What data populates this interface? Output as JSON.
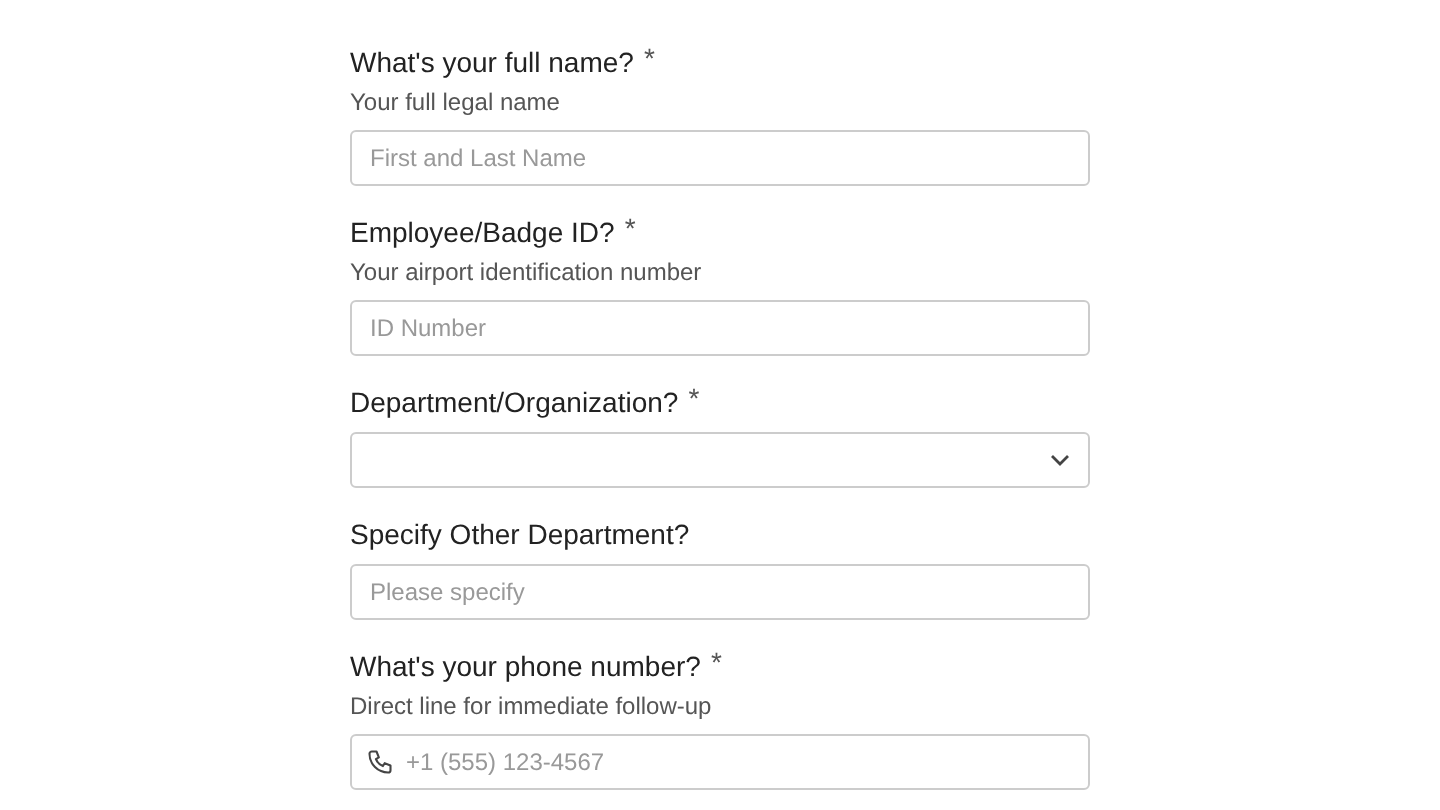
{
  "fields": [
    {
      "kind": "text",
      "label": "What's your full name?",
      "required_mark": "*",
      "hint": "Your full legal name",
      "placeholder": "First and Last Name"
    },
    {
      "kind": "text",
      "label": "Employee/Badge ID?",
      "required_mark": "*",
      "hint": "Your airport identification number",
      "placeholder": "ID Number"
    },
    {
      "kind": "select",
      "label": "Department/Organization?",
      "required_mark": "*"
    },
    {
      "kind": "text",
      "label": "Specify Other Department?",
      "placeholder": "Please specify"
    },
    {
      "kind": "phone",
      "label": "What's your phone number?",
      "required_mark": "*",
      "hint": "Direct line for immediate follow-up",
      "placeholder": "+1 (555) 123-4567"
    }
  ]
}
